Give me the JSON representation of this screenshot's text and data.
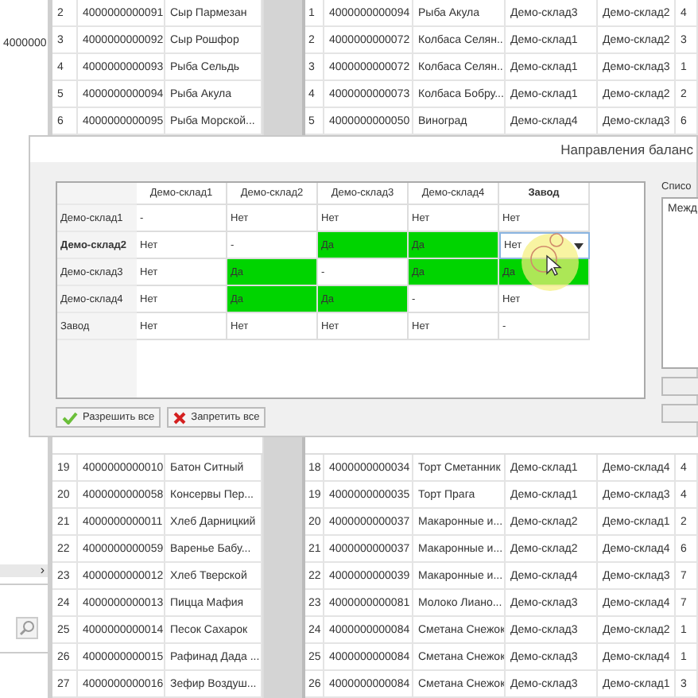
{
  "left_panel": {
    "text": "4000000",
    "scroll_arrow": "›"
  },
  "top_left_rows": [
    {
      "num": "2",
      "code": "4000000000091",
      "name": "Сыр Пармезан"
    },
    {
      "num": "3",
      "code": "4000000000092",
      "name": "Сыр Рошфор"
    },
    {
      "num": "4",
      "code": "4000000000093",
      "name": "Рыба Сельдь"
    },
    {
      "num": "5",
      "code": "4000000000094",
      "name": "Рыба Акула"
    },
    {
      "num": "6",
      "code": "4000000000095",
      "name": "Рыба Морской..."
    }
  ],
  "top_right_rows": [
    {
      "num": "1",
      "code": "4000000000094",
      "name": "Рыба Акула",
      "from": "Демо-склад3",
      "to": "Демо-склад2",
      "column_6": "4"
    },
    {
      "num": "2",
      "code": "4000000000072",
      "name": "Колбаса Селян...",
      "from": "Демо-склад1",
      "to": "Демо-склад2",
      "column_6": "3"
    },
    {
      "num": "3",
      "code": "4000000000072",
      "name": "Колбаса Селян...",
      "from": "Демо-склад1",
      "to": "Демо-склад3",
      "column_6": "1"
    },
    {
      "num": "4",
      "code": "4000000000073",
      "name": "Колбаса Бобру...",
      "from": "Демо-склад1",
      "to": "Демо-склад2",
      "column_6": "2"
    },
    {
      "num": "5",
      "code": "4000000000050",
      "name": "Виноград",
      "from": "Демо-склад4",
      "to": "Демо-склад3",
      "column_6": "6"
    }
  ],
  "dialog": {
    "title": "Направления баланс",
    "matrix": {
      "columns": [
        "Демо-склад1",
        "Демо-склад2",
        "Демо-склад3",
        "Демо-склад4",
        "Завод"
      ],
      "rows": [
        {
          "label": "Демо-склад1",
          "selected": false,
          "cells": [
            {
              "text": "-",
              "highlighted": false,
              "editing": false
            },
            {
              "text": "Нет",
              "highlighted": false,
              "editing": false
            },
            {
              "text": "Нет",
              "highlighted": false,
              "editing": false
            },
            {
              "text": "Нет",
              "highlighted": false,
              "editing": false
            },
            {
              "text": "Нет",
              "highlighted": false,
              "editing": false
            }
          ]
        },
        {
          "label": "Демо-склад2",
          "selected": true,
          "cells": [
            {
              "text": "Нет",
              "highlighted": false,
              "editing": false
            },
            {
              "text": "-",
              "highlighted": false,
              "editing": false
            },
            {
              "text": "Да",
              "highlighted": true,
              "editing": false
            },
            {
              "text": "Да",
              "highlighted": true,
              "editing": false
            },
            {
              "text": "Нет",
              "highlighted": false,
              "editing": true
            }
          ]
        },
        {
          "label": "Демо-склад3",
          "selected": false,
          "cells": [
            {
              "text": "Нет",
              "highlighted": false,
              "editing": false
            },
            {
              "text": "Да",
              "highlighted": true,
              "editing": false
            },
            {
              "text": "-",
              "highlighted": false,
              "editing": false
            },
            {
              "text": "Да",
              "highlighted": true,
              "editing": false
            },
            {
              "text": "Да",
              "highlighted": true,
              "editing": false
            }
          ]
        },
        {
          "label": "Демо-склад4",
          "selected": false,
          "cells": [
            {
              "text": "Нет",
              "highlighted": false,
              "editing": false
            },
            {
              "text": "Да",
              "highlighted": true,
              "editing": false
            },
            {
              "text": "Да",
              "highlighted": true,
              "editing": false
            },
            {
              "text": "-",
              "highlighted": false,
              "editing": false
            },
            {
              "text": "Нет",
              "highlighted": false,
              "editing": false
            }
          ]
        },
        {
          "label": "Завод",
          "selected": false,
          "cells": [
            {
              "text": "Нет",
              "highlighted": false,
              "editing": false
            },
            {
              "text": "Нет",
              "highlighted": false,
              "editing": false
            },
            {
              "text": "Нет",
              "highlighted": false,
              "editing": false
            },
            {
              "text": "Нет",
              "highlighted": false,
              "editing": false
            },
            {
              "text": "-",
              "highlighted": false,
              "editing": false
            }
          ]
        }
      ]
    },
    "list_label": "Списо",
    "list_items": [
      "Межд"
    ],
    "buttons": [
      {
        "label": "Разрешить все",
        "kind": "allow"
      },
      {
        "label": "Запретить все",
        "kind": "deny"
      }
    ]
  },
  "bottom_left_rows": [
    {
      "num": "19",
      "code": "4000000000010",
      "name": "Батон Ситный"
    },
    {
      "num": "20",
      "code": "4000000000058",
      "name": "Консервы Пер..."
    },
    {
      "num": "21",
      "code": "4000000000011",
      "name": "Хлеб Дарницкий"
    },
    {
      "num": "22",
      "code": "4000000000059",
      "name": "Варенье Бабу..."
    },
    {
      "num": "23",
      "code": "4000000000012",
      "name": "Хлеб Тверской"
    },
    {
      "num": "24",
      "code": "4000000000013",
      "name": "Пицца Мафия"
    },
    {
      "num": "25",
      "code": "4000000000014",
      "name": "Песок Сахарок"
    },
    {
      "num": "26",
      "code": "4000000000015",
      "name": "Рафинад Дада ..."
    },
    {
      "num": "27",
      "code": "4000000000016",
      "name": "Зефир Воздуш..."
    }
  ],
  "bottom_right_rows": [
    {
      "num": "18",
      "code": "4000000000034",
      "name": "Торт Сметанник",
      "from": "Демо-склад1",
      "to": "Демо-склад4",
      "column_6": "4"
    },
    {
      "num": "19",
      "code": "4000000000035",
      "name": "Торт Прага",
      "from": "Демо-склад1",
      "to": "Демо-склад3",
      "column_6": "4"
    },
    {
      "num": "20",
      "code": "4000000000037",
      "name": "Макаронные и...",
      "from": "Демо-склад2",
      "to": "Демо-склад1",
      "column_6": "2"
    },
    {
      "num": "21",
      "code": "4000000000037",
      "name": "Макаронные и...",
      "from": "Демо-склад2",
      "to": "Демо-склад4",
      "column_6": "6"
    },
    {
      "num": "22",
      "code": "4000000000039",
      "name": "Макаронные и...",
      "from": "Демо-склад4",
      "to": "Демо-склад3",
      "column_6": "7"
    },
    {
      "num": "23",
      "code": "4000000000081",
      "name": "Молоко Лиано...",
      "from": "Демо-склад3",
      "to": "Демо-склад4",
      "column_6": "7"
    },
    {
      "num": "24",
      "code": "4000000000084",
      "name": "Сметана Снежок",
      "from": "Демо-склад3",
      "to": "Демо-склад2",
      "column_6": "1"
    },
    {
      "num": "25",
      "code": "4000000000084",
      "name": "Сметана Снежок",
      "from": "Демо-склад3",
      "to": "Демо-склад4",
      "column_6": "1"
    },
    {
      "num": "26",
      "code": "4000000000084",
      "name": "Сметана Снежок",
      "from": "Демо-склад3",
      "to": "Демо-склад1",
      "column_6": "3"
    }
  ]
}
